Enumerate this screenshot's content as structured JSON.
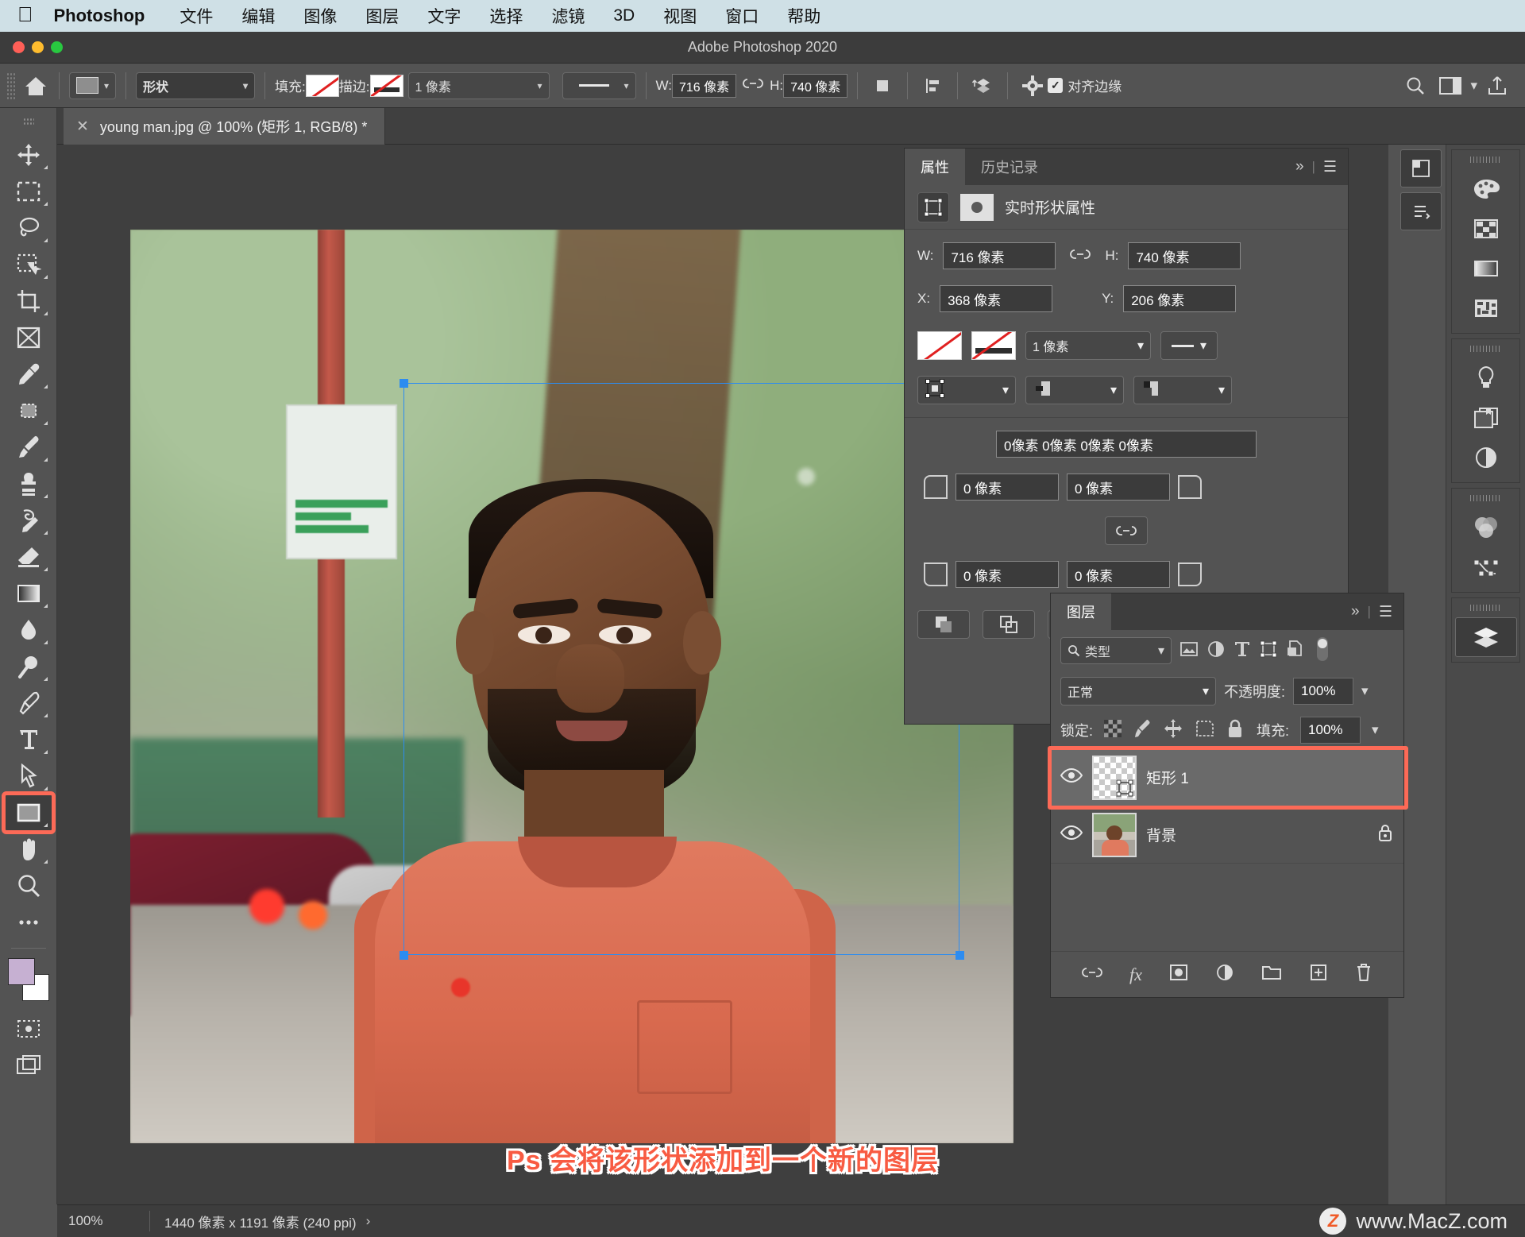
{
  "menubar": {
    "apple_icon": "apple-icon",
    "brand": "Photoshop",
    "items": [
      "文件",
      "编辑",
      "图像",
      "图层",
      "文字",
      "选择",
      "滤镜",
      "3D",
      "视图",
      "窗口",
      "帮助"
    ]
  },
  "window": {
    "title": "Adobe Photoshop 2020"
  },
  "options_bar": {
    "home_icon": "home-icon",
    "shape_preset_icon": "shape-preset-icon",
    "tool_mode": "形状",
    "fill_label": "填充:",
    "stroke_label": "描边:",
    "stroke_width": "1 像素",
    "stroke_style_icon": "line-style-icon",
    "w_label": "W:",
    "w_value": "716 像素",
    "link_icon": "link-icon",
    "h_label": "H:",
    "h_value": "740 像素",
    "path_ops_icon": "path-operations-icon",
    "path_align_icon": "path-align-icon",
    "path_arrange_icon": "path-arrange-icon",
    "gear_icon": "gear-icon",
    "align_edges_label": "对齐边缘",
    "align_edges_checked": true,
    "search_icon": "search-icon",
    "workspace_icon": "workspace-icon",
    "share_icon": "share-icon"
  },
  "document_tab": {
    "close_icon": "close-icon",
    "title": "young man.jpg @ 100% (矩形 1, RGB/8) *"
  },
  "toolbar": {
    "tools": [
      {
        "name": "move-tool",
        "icon": "move-icon",
        "selected": false
      },
      {
        "name": "rectangular-marquee-tool",
        "icon": "marquee-icon",
        "selected": false
      },
      {
        "name": "lasso-tool",
        "icon": "lasso-icon",
        "selected": false
      },
      {
        "name": "quick-selection-tool",
        "icon": "quick-select-icon",
        "selected": false
      },
      {
        "name": "crop-tool",
        "icon": "crop-icon",
        "selected": false
      },
      {
        "name": "frame-tool",
        "icon": "frame-icon",
        "selected": false
      },
      {
        "name": "eyedropper-tool",
        "icon": "eyedropper-icon",
        "selected": false
      },
      {
        "name": "healing-brush-tool",
        "icon": "healing-icon",
        "selected": false
      },
      {
        "name": "brush-tool",
        "icon": "brush-icon",
        "selected": false
      },
      {
        "name": "clone-stamp-tool",
        "icon": "stamp-icon",
        "selected": false
      },
      {
        "name": "history-brush-tool",
        "icon": "history-brush-icon",
        "selected": false
      },
      {
        "name": "eraser-tool",
        "icon": "eraser-icon",
        "selected": false
      },
      {
        "name": "gradient-tool",
        "icon": "gradient-icon",
        "selected": false
      },
      {
        "name": "blur-tool",
        "icon": "blur-drop-icon",
        "selected": false
      },
      {
        "name": "dodge-tool",
        "icon": "dodge-icon",
        "selected": false
      },
      {
        "name": "pen-tool",
        "icon": "pen-icon",
        "selected": false
      },
      {
        "name": "type-tool",
        "icon": "type-icon",
        "selected": false
      },
      {
        "name": "path-selection-tool",
        "icon": "path-arrow-icon",
        "selected": false
      },
      {
        "name": "rectangle-tool",
        "icon": "rectangle-icon",
        "selected": true
      },
      {
        "name": "hand-tool",
        "icon": "hand-icon",
        "selected": false
      },
      {
        "name": "zoom-tool",
        "icon": "zoom-icon",
        "selected": false
      },
      {
        "name": "more-tools",
        "icon": "ellipsis-icon",
        "selected": false
      }
    ],
    "foreground_color": "#c6b0d2",
    "background_color": "#ffffff",
    "quick-mask-icon": "quick-mask-icon",
    "screen-mode-icon": "screen-mode-icon"
  },
  "properties_panel": {
    "tabs": [
      {
        "label": "属性",
        "active": true
      },
      {
        "label": "历史记录",
        "active": false
      }
    ],
    "collapse_icon": "chevron-double-right-icon",
    "menu_icon": "panel-menu-icon",
    "header": "实时形状属性",
    "shape_icon": "live-shape-icon",
    "mask_icon": "mask-icon",
    "w_label": "W:",
    "w_value": "716 像素",
    "link_icon": "link-icon",
    "h_label": "H:",
    "h_value": "740 像素",
    "x_label": "X:",
    "x_value": "368 像素",
    "y_label": "Y:",
    "y_value": "206 像素",
    "fill_swatch_icon": "no-fill-icon",
    "stroke_swatch_icon": "no-stroke-icon",
    "stroke_width": "1 像素",
    "stroke_style_icon": "line-style-icon",
    "stroke_align_icon": "stroke-align-icon",
    "stroke_cap_icon": "stroke-cap-icon",
    "stroke_corner_icon": "stroke-corner-icon",
    "radius_summary": "0像素 0像素 0像素 0像素",
    "corner_tl": "0 像素",
    "corner_tr": "0 像素",
    "corner_bl": "0 像素",
    "corner_br": "0 像素",
    "corner_link_icon": "link-icon",
    "path_ops_icon": "path-operations-icon",
    "path_align_icon": "path-align-icon",
    "path_arrange_icon": "path-arrange-icon"
  },
  "layers_panel": {
    "tab": "图层",
    "collapse_icon": "chevron-double-right-icon",
    "menu_icon": "panel-menu-icon",
    "filter_icon": "search-icon",
    "filter_value": "类型",
    "filter_buttons": [
      "image-filter-icon",
      "adjustment-filter-icon",
      "type-filter-icon",
      "shape-filter-icon",
      "smartobject-filter-icon"
    ],
    "filter_toggle_icon": "toggle-icon",
    "blend_mode": "正常",
    "opacity_label": "不透明度:",
    "opacity_value": "100%",
    "lock_label": "锁定:",
    "lock_icons": [
      "lock-transparency-icon",
      "lock-image-icon",
      "lock-position-icon",
      "lock-artboard-icon",
      "lock-all-icon"
    ],
    "fill_label": "填充:",
    "fill_value": "100%",
    "layers": [
      {
        "name": "矩形 1",
        "visible_icon": "eye-icon",
        "selected": true,
        "locked": false,
        "thumb": "transparent-shape"
      },
      {
        "name": "背景",
        "visible_icon": "eye-icon",
        "selected": false,
        "locked": true,
        "lock_icon": "lock-icon",
        "thumb": "photo"
      }
    ],
    "bottom_buttons": [
      "link-layers-icon",
      "layer-style-icon",
      "layer-mask-icon",
      "adjustment-layer-icon",
      "new-group-icon",
      "new-layer-icon",
      "delete-layer-icon"
    ]
  },
  "right_dock": {
    "groups": [
      {
        "icons": [
          "color-palette-icon",
          "swatches-icon",
          "gradients-icon",
          "patterns-icon"
        ]
      },
      {
        "icons": [
          "learn-bulb-icon",
          "libraries-icon",
          "adjustments-icon"
        ]
      },
      {
        "icons": [
          "channels-icon",
          "paths-icon"
        ]
      },
      {
        "icons": [
          "layers-dock-icon"
        ]
      }
    ],
    "mini_buttons": [
      "properties-dock-icon",
      "history-dock-icon"
    ]
  },
  "canvas": {
    "caption": "Ps 会将该形状添加到一个新的图层",
    "selection": {
      "color": "#2d8cf0"
    }
  },
  "status_bar": {
    "zoom": "100%",
    "dimensions": "1440 像素 x 1191 像素 (240 ppi)",
    "chevron": "›",
    "watermark_logo": "Z",
    "watermark_text": "www.MacZ.com"
  },
  "colors": {
    "accent_red": "#fc6a57",
    "selection_blue": "#2d8cf0",
    "panel_bg": "#535353",
    "menubar_bg": "#cfe0e6"
  }
}
